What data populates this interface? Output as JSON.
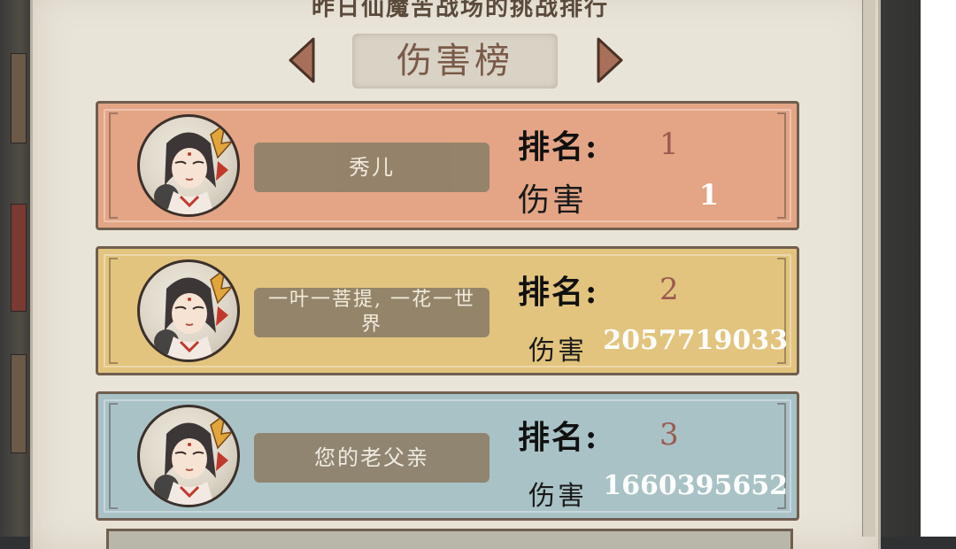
{
  "title": "昨日仙魔苦战场的挑战排行",
  "tab": {
    "label": "伤害榜"
  },
  "labels": {
    "rank": "排名:",
    "damage": "伤害"
  },
  "entries": [
    {
      "name": "秀儿",
      "rank": "1",
      "damage": "1",
      "color": "#e3a585"
    },
    {
      "name": "一叶一菩提, 一花一世界",
      "rank": "2",
      "damage": "2057719033",
      "color": "#e2c47e"
    },
    {
      "name": "您的老父亲",
      "rank": "3",
      "damage": "1660395652",
      "color": "#a9c2c6"
    }
  ],
  "colors": {
    "panel": "#e9e4d8",
    "arrow": "#9a6650",
    "rank_value": "#9b5a50"
  }
}
